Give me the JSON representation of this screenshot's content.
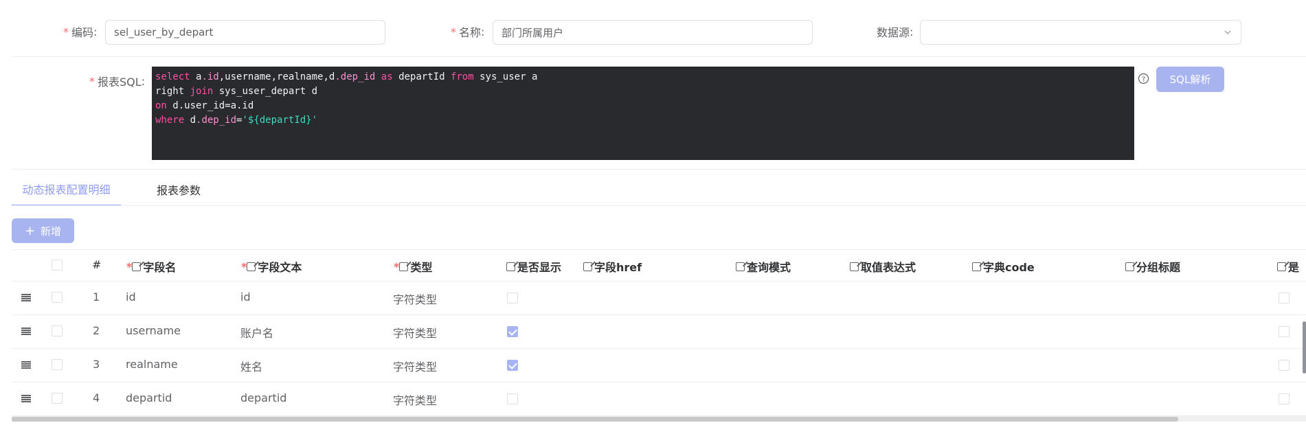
{
  "form": {
    "code": {
      "label": "编码",
      "value": "sel_user_by_depart"
    },
    "name": {
      "label": "名称",
      "value": "部门所属用户"
    },
    "datasource": {
      "label": "数据源",
      "value": ""
    },
    "sql_label": "报表SQL",
    "sql_button": "SQL解析"
  },
  "sql_lines": [
    [
      {
        "t": "select ",
        "c": "kw"
      },
      {
        "t": "a",
        "c": "fn"
      },
      {
        "t": ".id",
        "c": "prop"
      },
      {
        "t": ",username,realname,",
        "c": "fn"
      },
      {
        "t": "d",
        "c": "fn"
      },
      {
        "t": ".dep_id",
        "c": "prop"
      },
      {
        "t": " as ",
        "c": "kw"
      },
      {
        "t": "departId ",
        "c": "fn"
      },
      {
        "t": "from",
        "c": "kw"
      },
      {
        "t": " sys_user a",
        "c": "fn"
      }
    ],
    [
      {
        "t": "right ",
        "c": "fn"
      },
      {
        "t": "join",
        "c": "kw"
      },
      {
        "t": " sys_user_depart d",
        "c": "fn"
      }
    ],
    [
      {
        "t": "on",
        "c": "kw"
      },
      {
        "t": " d.user_id=a.id",
        "c": "fn"
      }
    ],
    [
      {
        "t": "where",
        "c": "kw"
      },
      {
        "t": " d",
        "c": "fn"
      },
      {
        "t": ".dep_id",
        "c": "prop"
      },
      {
        "t": "=",
        "c": "fn"
      },
      {
        "t": "'${departId}'",
        "c": "str"
      }
    ]
  ],
  "tabs": [
    {
      "label": "动态报表配置明细",
      "active": true
    },
    {
      "label": "报表参数",
      "active": false
    }
  ],
  "add_button": "新增",
  "table": {
    "headers": [
      {
        "label": "#",
        "required": false,
        "editable": false
      },
      {
        "label": "字段名",
        "required": true,
        "editable": true
      },
      {
        "label": "字段文本",
        "required": true,
        "editable": true
      },
      {
        "label": "类型",
        "required": true,
        "editable": true
      },
      {
        "label": "是否显示",
        "required": false,
        "editable": true
      },
      {
        "label": "字段href",
        "required": false,
        "editable": true
      },
      {
        "label": "查询模式",
        "required": false,
        "editable": true
      },
      {
        "label": "取值表达式",
        "required": false,
        "editable": true
      },
      {
        "label": "字典code",
        "required": false,
        "editable": true
      },
      {
        "label": "分组标题",
        "required": false,
        "editable": true
      },
      {
        "label": "是",
        "required": false,
        "editable": true
      }
    ],
    "rows": [
      {
        "num": "1",
        "field": "id",
        "text": "id",
        "type": "字符类型",
        "show": false
      },
      {
        "num": "2",
        "field": "username",
        "text": "账户名",
        "type": "字符类型",
        "show": true
      },
      {
        "num": "3",
        "field": "realname",
        "text": "姓名",
        "type": "字符类型",
        "show": true
      },
      {
        "num": "4",
        "field": "departid",
        "text": "departid",
        "type": "字符类型",
        "show": false
      }
    ]
  },
  "colors": {
    "accent": "#a8b4f0",
    "required": "#f56c6c",
    "code_bg": "#282a2e"
  }
}
